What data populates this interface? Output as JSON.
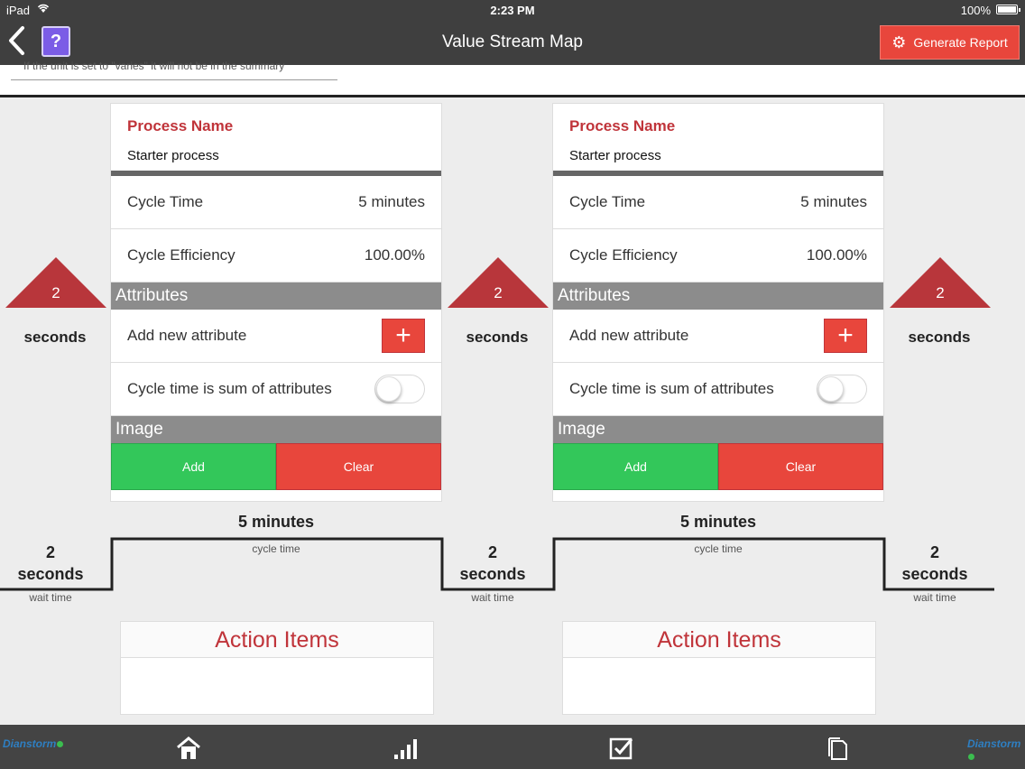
{
  "status": {
    "carrier": "iPad",
    "time": "2:23 PM",
    "battery": "100%"
  },
  "nav": {
    "title": "Value Stream Map",
    "help_label": "?",
    "generate_label": "Generate Report"
  },
  "summary_hint": "If the unit is set to \"varies\" it will not be in the summary",
  "inventory": [
    {
      "value": "2",
      "unit": "seconds"
    },
    {
      "value": "2",
      "unit": "seconds"
    },
    {
      "value": "2",
      "unit": "seconds"
    }
  ],
  "processes": [
    {
      "name_label": "Process Name",
      "name": "Starter process",
      "cycle_time_label": "Cycle Time",
      "cycle_time": "5 minutes",
      "efficiency_label": "Cycle Efficiency",
      "efficiency": "100.00%",
      "attributes_label": "Attributes",
      "add_attribute_label": "Add new attribute",
      "sum_label": "Cycle time is sum of attributes",
      "sum_enabled": false,
      "image_label": "Image",
      "add_label": "Add",
      "clear_label": "Clear",
      "timeline_value": "5 minutes",
      "timeline_label": "cycle time",
      "action_items_title": "Action Items"
    },
    {
      "name_label": "Process Name",
      "name": "Starter process",
      "cycle_time_label": "Cycle Time",
      "cycle_time": "5 minutes",
      "efficiency_label": "Cycle Efficiency",
      "efficiency": "100.00%",
      "attributes_label": "Attributes",
      "add_attribute_label": "Add new attribute",
      "sum_label": "Cycle time is sum of attributes",
      "sum_enabled": false,
      "image_label": "Image",
      "add_label": "Add",
      "clear_label": "Clear",
      "timeline_value": "5 minutes",
      "timeline_label": "cycle time",
      "action_items_title": "Action Items"
    }
  ],
  "wait_times": [
    {
      "value": "2",
      "unit": "seconds",
      "label": "wait time"
    },
    {
      "value": "2",
      "unit": "seconds",
      "label": "wait time"
    },
    {
      "value": "2",
      "unit": "seconds",
      "label": "wait time"
    }
  ],
  "tabbar": {
    "logo_text": "Dianstorm"
  },
  "colors": {
    "accent_red": "#e8463c",
    "title_red": "#c0343a",
    "add_green": "#33c75a",
    "help_purple": "#7b5ce6"
  },
  "icons": [
    "back-chevron-icon",
    "gear-icon",
    "plus-icon",
    "home-icon",
    "bar-chart-icon",
    "checkbox-icon",
    "document-icon"
  ]
}
